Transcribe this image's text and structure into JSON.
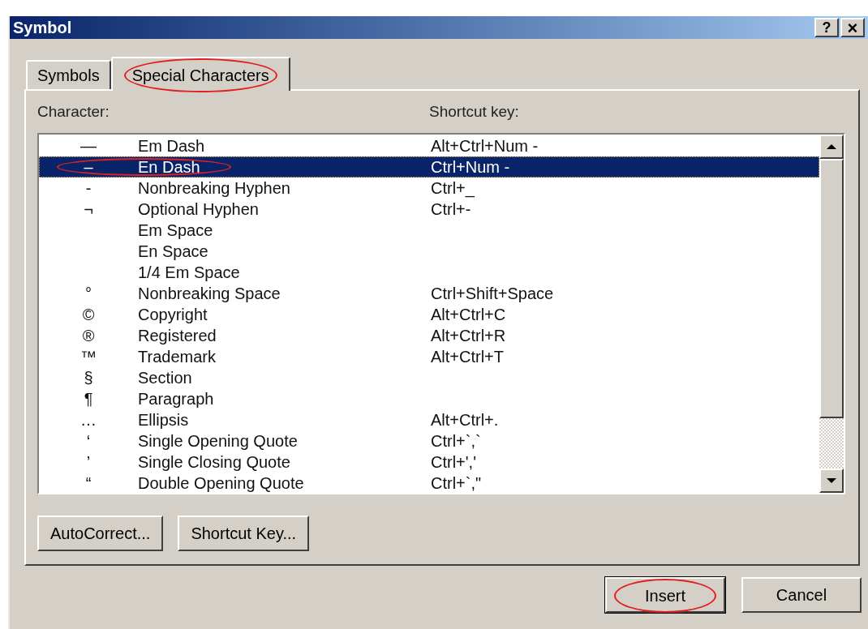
{
  "window": {
    "title": "Symbol",
    "help_button": "?",
    "close_button": "×"
  },
  "tabs": [
    {
      "label": "Symbols",
      "selected": false,
      "circled": false
    },
    {
      "label": "Special Characters",
      "selected": true,
      "circled": true
    }
  ],
  "list": {
    "columns": [
      "Character:",
      "Shortcut key:"
    ],
    "rows": [
      {
        "character": "—",
        "name": "Em Dash",
        "shortcut": "Alt+Ctrl+Num -",
        "selected": false,
        "circled": false
      },
      {
        "character": "–",
        "name": "En Dash",
        "shortcut": "Ctrl+Num -",
        "selected": true,
        "circled": true
      },
      {
        "character": "-",
        "name": "Nonbreaking Hyphen",
        "shortcut": "Ctrl+_",
        "selected": false,
        "circled": false
      },
      {
        "character": "¬",
        "name": "Optional Hyphen",
        "shortcut": "Ctrl+-",
        "selected": false,
        "circled": false
      },
      {
        "name": "Em Space",
        "selected": false,
        "circled": false
      },
      {
        "name": "En Space",
        "selected": false,
        "circled": false
      },
      {
        "name": "1/4 Em Space",
        "selected": false,
        "circled": false
      },
      {
        "character": "°",
        "name": "Nonbreaking Space",
        "shortcut": "Ctrl+Shift+Space",
        "selected": false,
        "circled": false
      },
      {
        "character": "©",
        "name": "Copyright",
        "shortcut": "Alt+Ctrl+C",
        "selected": false,
        "circled": false
      },
      {
        "character": "®",
        "name": "Registered",
        "shortcut": "Alt+Ctrl+R",
        "selected": false,
        "circled": false
      },
      {
        "character": "™",
        "name": "Trademark",
        "shortcut": "Alt+Ctrl+T",
        "selected": false,
        "circled": false
      },
      {
        "character": "§",
        "name": "Section",
        "selected": false,
        "circled": false
      },
      {
        "character": "¶",
        "name": "Paragraph",
        "selected": false,
        "circled": false
      },
      {
        "character": "…",
        "name": "Ellipsis",
        "shortcut": "Alt+Ctrl+.",
        "selected": false,
        "circled": false
      },
      {
        "character": "‘",
        "name": "Single Opening Quote",
        "shortcut": "Ctrl+`,`",
        "selected": false,
        "circled": false
      },
      {
        "character": "’",
        "name": "Single Closing Quote",
        "shortcut": "Ctrl+','",
        "selected": false,
        "circled": false
      },
      {
        "character": "“",
        "name": "Double Opening Quote",
        "shortcut": "Ctrl+`,\"",
        "selected": false,
        "circled": false
      }
    ]
  },
  "panel_buttons": [
    {
      "label": "AutoCorrect..."
    },
    {
      "label": "Shortcut Key..."
    }
  ],
  "dialog_buttons": [
    {
      "label": "Insert",
      "default": true,
      "circled": true
    },
    {
      "label": "Cancel",
      "default": false,
      "circled": false
    }
  ]
}
